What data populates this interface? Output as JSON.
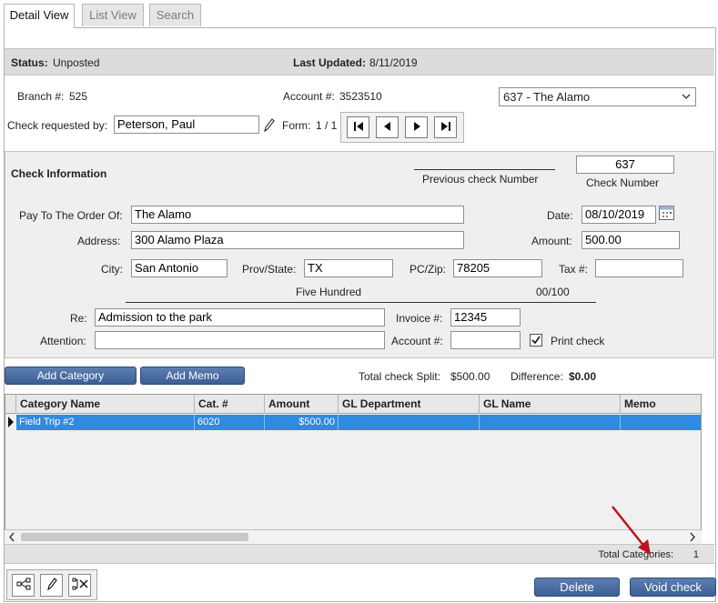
{
  "tabs": [
    {
      "label": "Detail View",
      "active": true
    },
    {
      "label": "List View",
      "active": false
    },
    {
      "label": "Search",
      "active": false
    }
  ],
  "status": {
    "status_label": "Status:",
    "status_value": "Unposted",
    "updated_label": "Last Updated:",
    "updated_value": "8/11/2019"
  },
  "header": {
    "branch_label": "Branch #:",
    "branch_value": "525",
    "account_label": "Account #:",
    "account_value": "3523510",
    "account_select": "637 - The Alamo",
    "requested_label": "Check requested by:",
    "requested_value": "Peterson, Paul",
    "form_label": "Form:",
    "form_value": "1 / 1"
  },
  "check_info": {
    "section_title": "Check Information",
    "previous_check_label": "Previous check Number",
    "previous_check_value": "",
    "check_number_value": "637",
    "check_number_label": "Check Number",
    "pay_to_label": "Pay To The Order Of:",
    "pay_to_value": "The Alamo",
    "date_label": "Date:",
    "date_value": "08/10/2019",
    "address_label": "Address:",
    "address_value": "300 Alamo Plaza",
    "amount_label": "Amount:",
    "amount_value": "500.00",
    "city_label": "City:",
    "city_value": "San Antonio",
    "prov_label": "Prov/State:",
    "prov_value": "TX",
    "zip_label": "PC/Zip:",
    "zip_value": "78205",
    "tax_label": "Tax #:",
    "tax_value": "",
    "amount_words": "Five Hundred",
    "cents": "00/100",
    "re_label": "Re:",
    "re_value": "Admission to the park",
    "invoice_label": "Invoice #:",
    "invoice_value": "12345",
    "attention_label": "Attention:",
    "attention_value": "",
    "account2_label": "Account #:",
    "account2_value": "",
    "print_check_label": "Print check",
    "print_check_checked": true
  },
  "split": {
    "add_category_label": "Add Category",
    "add_memo_label": "Add Memo",
    "total_split_label": "Total check Split:",
    "total_split_value": "$500.00",
    "difference_label": "Difference:",
    "difference_value": "$0.00"
  },
  "grid": {
    "columns": [
      "Category Name",
      "Cat. #",
      "Amount",
      "GL Department",
      "GL Name",
      "Memo"
    ],
    "rows": [
      {
        "category": "Field Trip #2",
        "cat_no": "6020",
        "amount": "$500.00",
        "gl_department": "",
        "gl_name": "",
        "memo": ""
      }
    ]
  },
  "footer": {
    "total_categories_label": "Total Categories:",
    "total_categories_value": "1"
  },
  "actions": {
    "delete_label": "Delete",
    "void_label": "Void check"
  },
  "colors": {
    "accent_button": "#4a6da3",
    "selected_row": "#2f8ae0",
    "annotation_arrow": "#c0121c"
  },
  "icons": [
    "pencil-icon",
    "first-record-icon",
    "previous-record-icon",
    "next-record-icon",
    "last-record-icon",
    "calendar-icon",
    "split-icon",
    "edit-icon",
    "remove-split-icon",
    "row-pointer-icon",
    "scroll-left-icon",
    "scroll-right-icon",
    "checkbox-icon",
    "chevron-down-icon"
  ]
}
